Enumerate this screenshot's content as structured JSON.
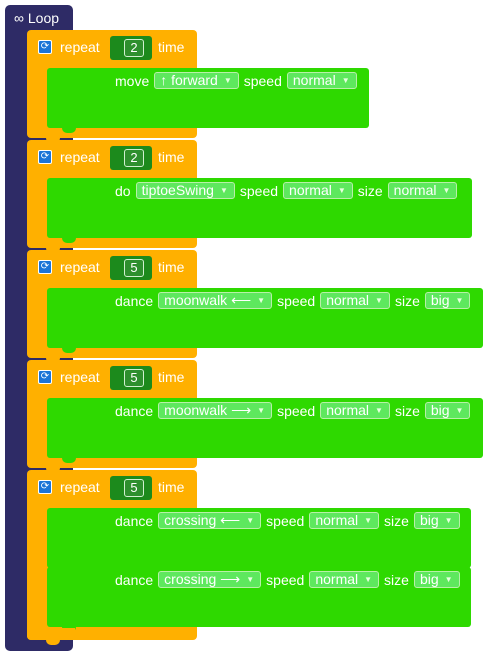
{
  "loop": {
    "label": "∞ Loop"
  },
  "repeat_blocks": [
    {
      "repeat_label": "repeat",
      "times": "2",
      "time_label": "time",
      "steps": [
        {
          "verb": "move",
          "action": "↑ forward",
          "speed_label": "speed",
          "speed": "normal",
          "size_label": "",
          "size": ""
        }
      ]
    },
    {
      "repeat_label": "repeat",
      "times": "2",
      "time_label": "time",
      "steps": [
        {
          "verb": "do",
          "action": "tiptoeSwing",
          "speed_label": "speed",
          "speed": "normal",
          "size_label": "size",
          "size": "normal"
        }
      ]
    },
    {
      "repeat_label": "repeat",
      "times": "5",
      "time_label": "time",
      "steps": [
        {
          "verb": "dance",
          "action": "moonwalk ⟵",
          "speed_label": "speed",
          "speed": "normal",
          "size_label": "size",
          "size": "big"
        }
      ]
    },
    {
      "repeat_label": "repeat",
      "times": "5",
      "time_label": "time",
      "steps": [
        {
          "verb": "dance",
          "action": "moonwalk ⟶",
          "speed_label": "speed",
          "speed": "normal",
          "size_label": "size",
          "size": "big"
        }
      ]
    },
    {
      "repeat_label": "repeat",
      "times": "5",
      "time_label": "time",
      "steps": [
        {
          "verb": "dance",
          "action": "crossing ⟵",
          "speed_label": "speed",
          "speed": "normal",
          "size_label": "size",
          "size": "big"
        },
        {
          "verb": "dance",
          "action": "crossing ⟶",
          "speed_label": "speed",
          "speed": "normal",
          "size_label": "size",
          "size": "big"
        }
      ]
    }
  ],
  "colors": {
    "loop": "#2e2b66",
    "repeat": "#ffb000",
    "action": "#2ed900",
    "number_tab": "#1c8a1c",
    "repeat_icon": "#1b74d8"
  },
  "icons": {
    "repeat_icon": "repeat-arrows",
    "dropdown": "triangle-down"
  }
}
